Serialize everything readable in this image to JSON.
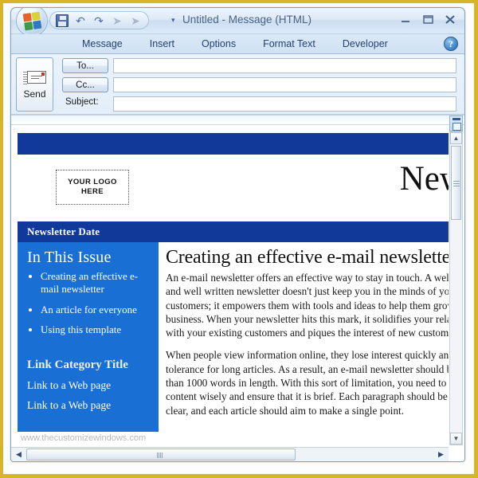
{
  "window": {
    "title": "Untitled - Message (HTML)",
    "office_orb": "office-orb-icon",
    "quick_access": [
      {
        "name": "save-icon",
        "label": "Save"
      },
      {
        "name": "undo-icon",
        "label": "Undo",
        "glyph": "↶"
      },
      {
        "name": "redo-icon",
        "label": "Redo",
        "glyph": "↷"
      },
      {
        "name": "previous-item-icon",
        "label": "Previous Item",
        "glyph": "➤"
      },
      {
        "name": "next-item-icon",
        "label": "Next Item",
        "glyph": "➤"
      }
    ],
    "qat_overflow": "▾",
    "controls": {
      "minimize": "–",
      "maximize": "□",
      "close": "✕"
    }
  },
  "ribbon": {
    "tabs": [
      {
        "label": "Message"
      },
      {
        "label": "Insert"
      },
      {
        "label": "Options"
      },
      {
        "label": "Format Text"
      },
      {
        "label": "Developer"
      }
    ],
    "help_label": "?"
  },
  "header": {
    "send_label": "Send",
    "to_button": "To...",
    "cc_button": "Cc...",
    "subject_label": "Subject:",
    "to_value": "",
    "cc_value": "",
    "subject_value": "",
    "to_placeholder": "",
    "cc_placeholder": "",
    "subject_placeholder": ""
  },
  "newsletter": {
    "logo_line1": "YOUR LOGO",
    "logo_line2": "HERE",
    "masthead_title": "Newsletter",
    "date_bar": "Newsletter Date",
    "sidebar": {
      "heading": "In This Issue",
      "items": [
        "Creating an effective e-mail newsletter",
        "An article for everyone",
        "Using this template"
      ],
      "category_title": "Link Category Title",
      "links": [
        "Link to a Web page",
        "Link to a Web page"
      ]
    },
    "article": {
      "title": "Creating an effective e-mail newsletter",
      "paragraphs": [
        "An e-mail newsletter offers an effective way to stay in touch. A well designed and well written newsletter doesn't just keep you in the minds of your customers; it empowers them with tools and ideas to help them grow their own business. When your newsletter hits this mark, it solidifies your relationship with your existing customers and piques the interest of new customers.",
        "When people view information online, they lose interest quickly and have little tolerance for long articles. As a result, an e-mail newsletter should be no more than 1000 words in length. With this sort of limitation, you need to choose your content wisely and ensure that it is brief. Each paragraph should be short and clear, and each article should aim to make a single point."
      ]
    }
  },
  "scrollbars": {
    "vertical_up": "▲",
    "vertical_down": "▼",
    "horizontal_left": "◀",
    "horizontal_right": "▶"
  },
  "watermark": "www.thecustomizewindows.com",
  "colors": {
    "navy_bar": "#11399a",
    "sidebar_blue": "#1a6fd4",
    "frame_gold": "#d8b429",
    "title_text": "#4a6484",
    "tab_text": "#234270"
  }
}
